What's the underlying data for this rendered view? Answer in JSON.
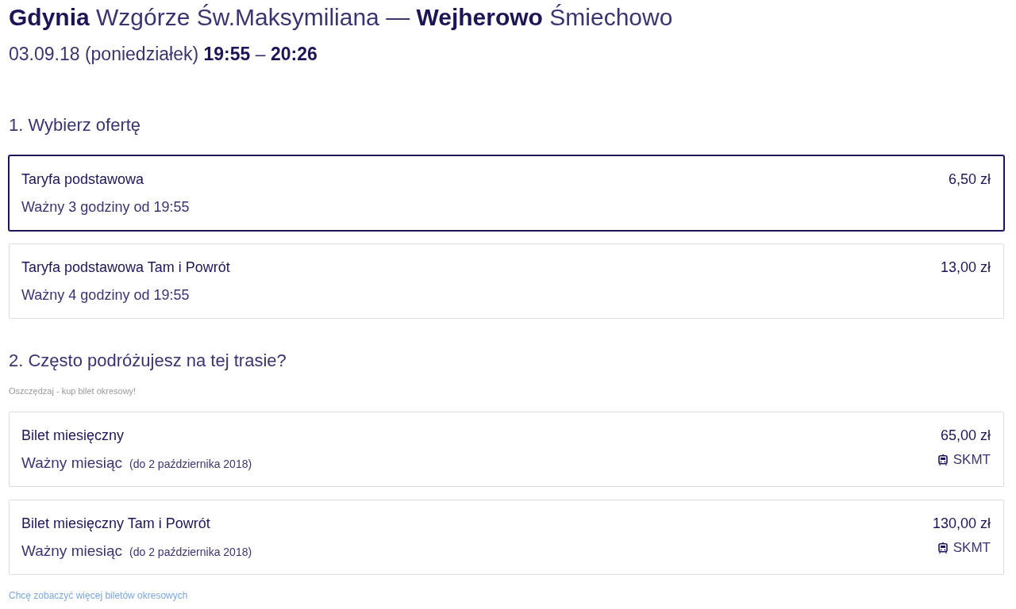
{
  "header": {
    "route": "**Gdynia** Wzgórze Św.Maksymiliana — **Wejherowo** Śmiechowo",
    "schedule": "03.09.18 (poniedziałek) **19:55** – **20:26**"
  },
  "offers_section": {
    "heading": "1. Wybierz ofertę",
    "offers": [
      {
        "name": "Taryfa podstawowa",
        "validity": "Ważny 3 godziny od 19:55",
        "price": "6,50 zł",
        "selected": true
      },
      {
        "name": "Taryfa podstawowa Tam i Powrót",
        "validity": "Ważny 4 godziny od 19:55",
        "price": "13,00 zł",
        "selected": false
      }
    ]
  },
  "periodic_section": {
    "heading": "2. Często podróżujesz na tej trasie?",
    "subtitle": "Oszczędzaj - kup bilet okresowy!",
    "tickets": [
      {
        "name": "Bilet miesięczny",
        "validity": "Ważny miesiąc",
        "validity_note": "(do 2 października 2018)",
        "price": "65,00 zł",
        "carrier": "SKMT",
        "selected": false
      },
      {
        "name": "Bilet miesięczny Tam i Powrót",
        "validity": "Ważny miesiąc",
        "validity_note": "(do 2 października 2018)",
        "price": "130,00 zł",
        "carrier": "SKMT",
        "selected": false
      }
    ],
    "more_link": "Chcę zobaczyć więcej biletów okresowych"
  }
}
